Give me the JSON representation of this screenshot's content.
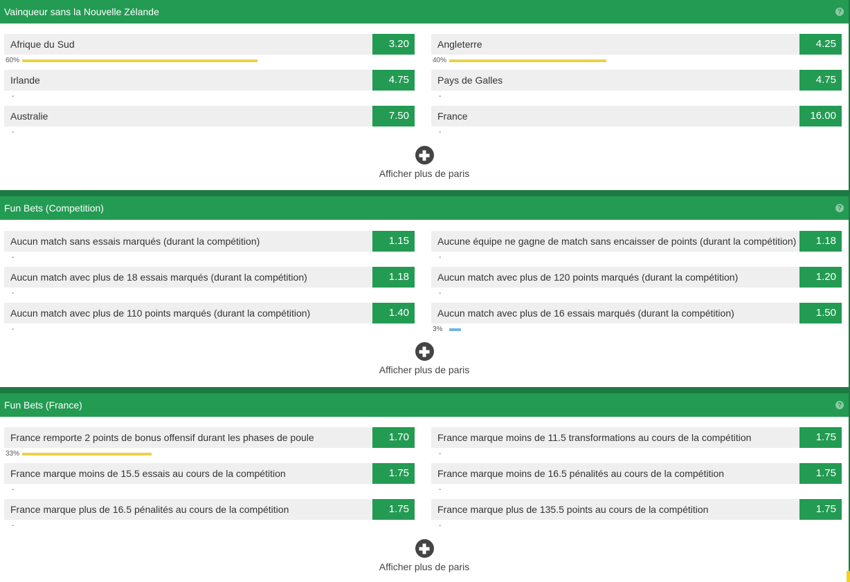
{
  "sections": [
    {
      "title": "Vainqueur sans la Nouvelle Zélande",
      "more_label": "Afficher plus de paris",
      "left": [
        {
          "name": "Afrique du Sud",
          "odds": "3.20",
          "pct": "60%",
          "pct_value": 60
        },
        {
          "name": "Irlande",
          "odds": "4.75",
          "pct": "-"
        },
        {
          "name": "Australie",
          "odds": "7.50",
          "pct": "-"
        }
      ],
      "right": [
        {
          "name": "Angleterre",
          "odds": "4.25",
          "pct": "40%",
          "pct_value": 40
        },
        {
          "name": "Pays de Galles",
          "odds": "4.75",
          "pct": "-"
        },
        {
          "name": "France",
          "odds": "16.00",
          "pct": "-"
        }
      ]
    },
    {
      "title": "Fun Bets (Competition)",
      "more_label": "Afficher plus de paris",
      "left": [
        {
          "name": "Aucun match sans essais marqués (durant la compétition)",
          "odds": "1.15",
          "pct": "-"
        },
        {
          "name": "Aucun match avec plus de 18 essais marqués (durant la compétition)",
          "odds": "1.18",
          "pct": "-"
        },
        {
          "name": "Aucun match avec plus de 110 points marqués (durant la compétition)",
          "odds": "1.40",
          "pct": "-"
        }
      ],
      "right": [
        {
          "name": "Aucune équipe ne gagne de match sans encaisser de points (durant la compétition)",
          "odds": "1.18",
          "pct": "-"
        },
        {
          "name": "Aucun match avec plus de 120 points marqués (durant la compétition)",
          "odds": "1.20",
          "pct": "-"
        },
        {
          "name": "Aucun match avec plus de 16 essais marqués (durant la compétition)",
          "odds": "1.50",
          "pct": "3%",
          "pct_value": 3,
          "bar_color": "blue"
        }
      ]
    },
    {
      "title": "Fun Bets (France)",
      "more_label": "Afficher plus de paris",
      "left": [
        {
          "name": "France remporte 2 points de bonus offensif durant les phases de poule",
          "odds": "1.70",
          "pct": "33%",
          "pct_value": 33
        },
        {
          "name": "France marque moins de 15.5 essais au cours de la compétition",
          "odds": "1.75",
          "pct": "-"
        },
        {
          "name": "France marque plus de 16.5 pénalités au cours de la compétition",
          "odds": "1.75",
          "pct": "-"
        }
      ],
      "right": [
        {
          "name": "France marque moins de 11.5 transformations au cours de la compétition",
          "odds": "1.75",
          "pct": "-"
        },
        {
          "name": "France marque moins de 16.5 pénalités au cours de la compétition",
          "odds": "1.75",
          "pct": "-"
        },
        {
          "name": "France marque plus de 135.5 points au cours de la compétition",
          "odds": "1.75",
          "pct": "-"
        }
      ]
    }
  ],
  "colors": {
    "header_green": "#239b53",
    "odds_green": "#239b53",
    "bar_yellow": "#e8d348",
    "bar_blue": "#72b6e0"
  },
  "icons": {
    "help": "question-circle-icon",
    "more": "plus-circle-icon"
  }
}
